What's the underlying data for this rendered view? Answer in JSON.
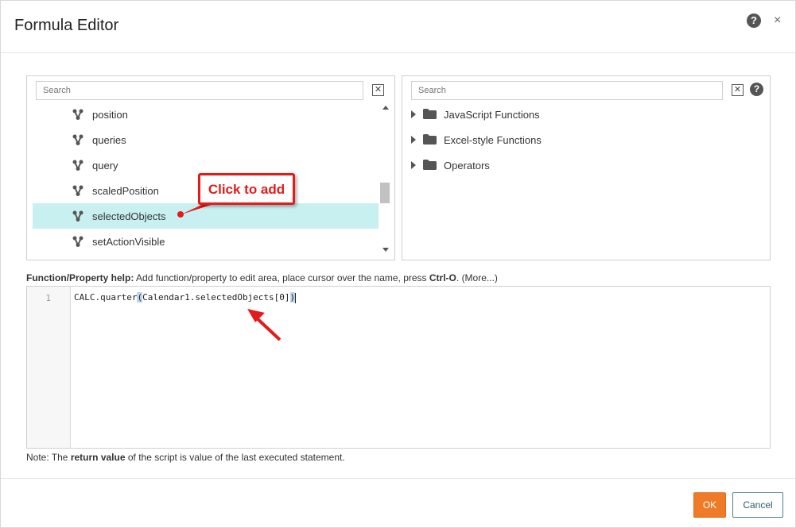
{
  "dialog": {
    "title": "Formula Editor",
    "help_icon": "question-circle-icon",
    "close_glyph": "×"
  },
  "left_panel": {
    "search_placeholder": "Search",
    "clear_glyph": "✕",
    "items": [
      {
        "label": "position",
        "icon": "property-icon"
      },
      {
        "label": "queries",
        "icon": "property-icon"
      },
      {
        "label": "query",
        "icon": "property-icon"
      },
      {
        "label": "scaledPosition",
        "icon": "property-icon"
      },
      {
        "label": "selectedObjects",
        "icon": "property-icon",
        "selected": true
      },
      {
        "label": "setActionVisible",
        "icon": "property-icon"
      }
    ]
  },
  "right_panel": {
    "search_placeholder": "Search",
    "clear_glyph": "✕",
    "help_glyph": "?",
    "folders": [
      {
        "label": "JavaScript Functions",
        "icon": "folder-icon"
      },
      {
        "label": "Excel-style Functions",
        "icon": "folder-icon"
      },
      {
        "label": "Operators",
        "icon": "folder-icon"
      }
    ]
  },
  "help_line": {
    "label": "Function/Property help:",
    "text_before": " Add function/property to edit area, place cursor over the name, press ",
    "shortcut": "Ctrl-O",
    "text_after": ". ",
    "more": "(More...)"
  },
  "editor": {
    "line_number": "1",
    "code_prefix": "CALC.quarter",
    "code_open": "(",
    "code_inner": "Calendar1.selectedObjects[0]",
    "code_close": ")"
  },
  "note": {
    "prefix": "Note: The ",
    "bold": "return value",
    "suffix": " of the script is value of the last executed statement."
  },
  "footer": {
    "ok_label": "OK",
    "cancel_label": "Cancel"
  },
  "annotation": {
    "callout_text": "Click to add",
    "color": "#e21b1b"
  },
  "colors": {
    "selected_row": "#c9f0f0",
    "ok_button": "#ef7b28",
    "cancel_border": "#4a8090",
    "bracket_highlight": "#bcd6ef"
  }
}
